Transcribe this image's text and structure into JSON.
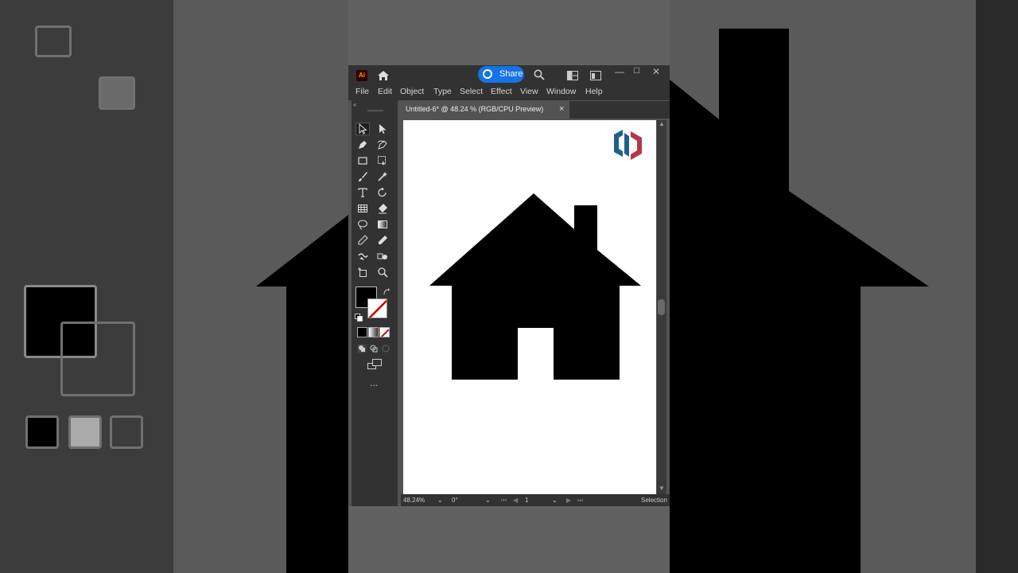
{
  "app": {
    "logo_text": "Ai",
    "share_label": "Share",
    "window_controls": {
      "minimize": "—",
      "restore": "☐",
      "close": "✕"
    }
  },
  "menu": [
    "File",
    "Edit",
    "Object",
    "Type",
    "Select",
    "Effect",
    "View",
    "Window",
    "Help"
  ],
  "document": {
    "tab_title": "Untitled-6* @ 48.24 % (RGB/CPU Preview)",
    "tab_close": "×"
  },
  "toolbar": {
    "collapse": "«",
    "more_tools": "..."
  },
  "status": {
    "zoom": "48.24%",
    "rotation": "0°",
    "artboard": "1",
    "tool_name": "Selection"
  },
  "colors": {
    "fill": "#000000",
    "accent": "#1473e6",
    "watermark_blue": "#1f5f8b",
    "watermark_red": "#b5364a"
  }
}
